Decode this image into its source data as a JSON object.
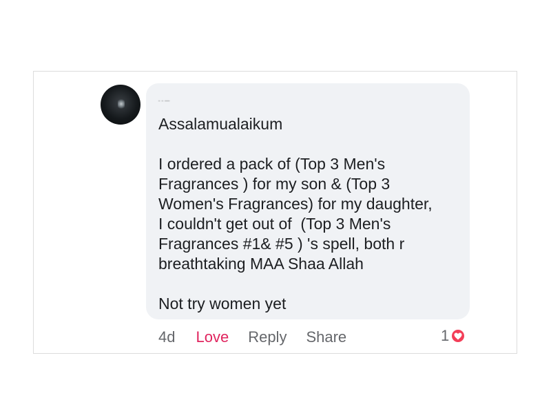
{
  "comment": {
    "author_name": "ـــ ـ ـ",
    "paragraphs": [
      "Assalamualaikum",
      "I ordered a pack of (Top 3 Men's\nFragrances ) for my son & (Top 3\nWomen's Fragrances) for my daughter,\nI couldn't get out of  (Top 3 Men's\nFragrances #1& #5 ) 's spell, both r\nbreathtaking MAA Shaa Allah",
      "Not try women yet"
    ]
  },
  "actions": {
    "time": "4d",
    "love_label": "Love",
    "reply_label": "Reply",
    "share_label": "Share"
  },
  "reactions": {
    "count": "1",
    "icon": "heart-icon",
    "badge_color": "#f33e58"
  },
  "colors": {
    "love_active": "#e0245e",
    "bubble_bg": "#f0f2f5",
    "muted_text": "#65676b"
  }
}
